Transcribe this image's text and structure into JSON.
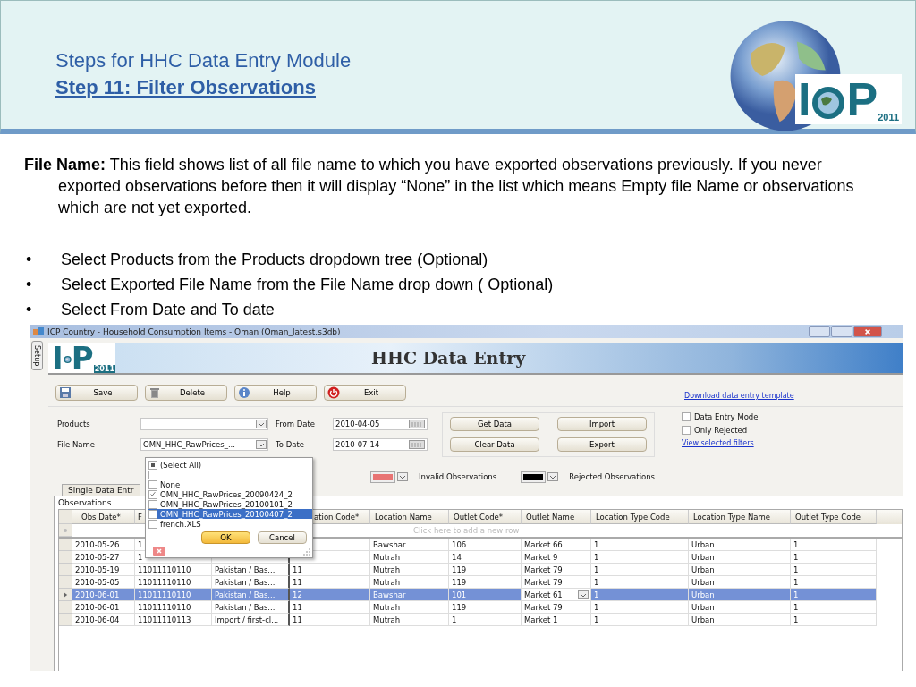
{
  "slide": {
    "title": "Steps for HHC Data Entry Module",
    "subtitle": "Step  11: Filter Observations",
    "logo": {
      "left": "I",
      "right": "P",
      "year": "2011"
    },
    "paragraph": "**File Name:**  This field shows list of all file name to which you have exported observations previously. If you never exported observations before then it will display “None” in the list which means Empty file Name or observations which are not yet exported.",
    "bullets": [
      {
        "marker": "•",
        "text": "Select Products from the Products dropdown tree (Optional)"
      },
      {
        "marker": "•",
        "text": "Select Exported File Name from the File Name drop down ( Optional)"
      },
      {
        "marker": "•",
        "text": "Select From Date and To date"
      }
    ]
  },
  "app": {
    "window": {
      "title": "ICP Country - Household Consumption Items - Oman (Oman_latest.s3db)"
    },
    "side_tab": "Setup",
    "banner": {
      "logo": {
        "left": "I",
        "right": "P",
        "year": "2011"
      },
      "title": "HHC Data Entry"
    },
    "toolbar": [
      {
        "label": "Save",
        "kind": "save"
      },
      {
        "label": "Delete",
        "kind": "delete"
      },
      {
        "label": "Help",
        "kind": "help"
      },
      {
        "label": "Exit",
        "kind": "exit"
      }
    ],
    "template_link": "Download data entry template",
    "filters": {
      "products": {
        "label": "Products"
      },
      "file_name": {
        "label": "File Name",
        "value": "OMN_HHC_RawPrices_..."
      },
      "from_date": {
        "label": "From Date",
        "value": "2010-04-05"
      },
      "to_date": {
        "label": "To Date",
        "value": "2010-07-14"
      }
    },
    "actions": [
      "Get Data",
      "Import",
      "Clear Data",
      "Export"
    ],
    "options": [
      {
        "label": "Data Entry Mode",
        "checked": false
      },
      {
        "label": "Only Rejected",
        "checked": false
      }
    ],
    "filters_link": "View selected filters",
    "legend": [
      {
        "label": "Invalid Observations",
        "color": "#e87474"
      },
      {
        "label": "Rejected Observations",
        "color": "#000000"
      }
    ],
    "tab": "Single Data Entr",
    "group_label": "Observations",
    "new_row_hint": "Click here to add a new row",
    "columns": [
      "Obs Date*",
      "F",
      null,
      "ation Code*",
      "Location Name",
      "Outlet Code*",
      "Outlet Name",
      "Location Type Code",
      "Location Type Name",
      "Outlet Type Code"
    ],
    "rows": [
      {
        "selected": false,
        "cells": [
          "2010-05-26",
          "1",
          null,
          null,
          "Bawshar",
          "106",
          "Market 66",
          "1",
          "Urban",
          "1"
        ]
      },
      {
        "selected": false,
        "cells": [
          "2010-05-27",
          "1",
          null,
          null,
          "Mutrah",
          "14",
          "Market 9",
          "1",
          "Urban",
          "1"
        ]
      },
      {
        "selected": false,
        "cells": [
          "2010-05-19",
          "11011110110",
          "Pakistan / Bas...",
          "11",
          "Mutrah",
          "119",
          "Market 79",
          "1",
          "Urban",
          "1"
        ]
      },
      {
        "selected": false,
        "cells": [
          "2010-05-05",
          "11011110110",
          "Pakistan / Bas...",
          "11",
          "Mutrah",
          "119",
          "Market 79",
          "1",
          "Urban",
          "1"
        ]
      },
      {
        "selected": true,
        "cells": [
          "2010-06-01",
          "11011110110",
          "Pakistan / Bas...",
          "12",
          "Bawshar",
          "101",
          "Market 61",
          "1",
          "Urban",
          "1"
        ]
      },
      {
        "selected": false,
        "cells": [
          "2010-06-01",
          "11011110110",
          "Pakistan / Bas...",
          "11",
          "Mutrah",
          "119",
          "Market 79",
          "1",
          "Urban",
          "1"
        ]
      },
      {
        "selected": false,
        "cells": [
          "2010-06-04",
          "11011110113",
          "Import / first-cl...",
          "11",
          "Mutrah",
          "1",
          "Market 1",
          "1",
          "Urban",
          "1"
        ]
      }
    ],
    "dropdown": {
      "items": [
        {
          "label": "(Select All)",
          "kind": "all",
          "indeterminate": true,
          "selected": false
        },
        {
          "kind": "blank",
          "checked": false,
          "selected": false
        },
        {
          "label": "None",
          "kind": "item",
          "checked": false,
          "selected": false
        },
        {
          "label": "OMN_HHC_RawPrices_20090424_2",
          "kind": "item",
          "checked": true,
          "selected": false
        },
        {
          "label": "OMN_HHC_RawPrices_20100101_2",
          "kind": "item",
          "checked": false,
          "selected": false
        },
        {
          "label": "OMN_HHC_RawPrices_20100407_2",
          "kind": "item",
          "checked": false,
          "selected": true
        },
        {
          "label": "french.XLS",
          "kind": "item",
          "checked": false,
          "selected": false
        }
      ],
      "ok": "OK",
      "cancel": "Cancel"
    }
  }
}
